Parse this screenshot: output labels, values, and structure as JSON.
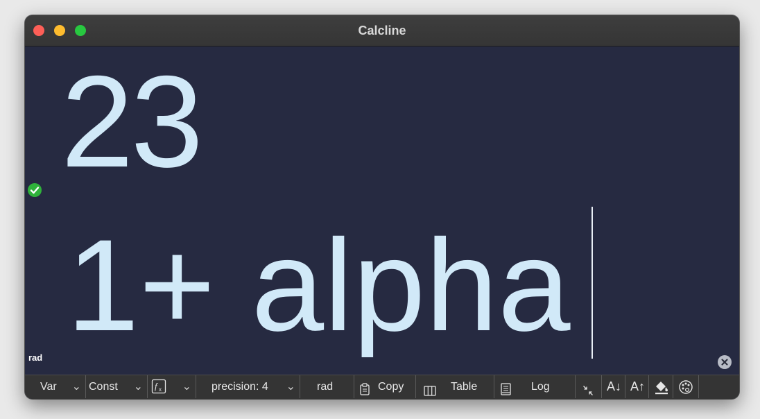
{
  "window": {
    "title": "Calcline"
  },
  "display": {
    "result": "23",
    "expression": "1+ alpha",
    "mode_indicator": "rad"
  },
  "icons": {
    "valid": "checkmark-circle-icon",
    "clear": "clear-x-icon",
    "function": "function-fx-icon",
    "copy": "clipboard-icon",
    "table": "table-columns-icon",
    "log": "document-lines-icon",
    "collapse": "collapse-arrows-icon",
    "fill": "paint-bucket-icon",
    "theme": "palette-icon"
  },
  "toolbar": {
    "var_label": "Var",
    "const_label": "Const",
    "precision_label": "precision: 4",
    "angle_label": "rad",
    "copy_label": "Copy",
    "table_label": "Table",
    "log_label": "Log",
    "font_decrease_label": "A↓",
    "font_increase_label": "A↑",
    "dropdown_glyph": "⌄"
  },
  "colors": {
    "background": "#262a41",
    "text": "#d1e9f8",
    "check": "#2fb33b",
    "titlebar": "#3a3a3a",
    "toolbar": "#343434"
  }
}
